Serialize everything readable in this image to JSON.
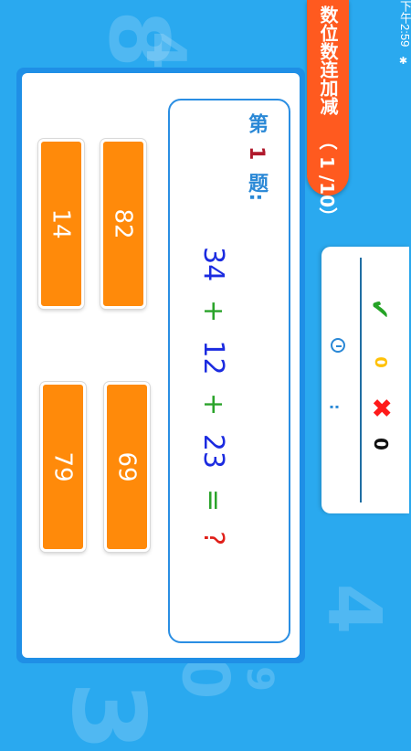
{
  "status_bar": {
    "time": "下午2:59",
    "bluetooth_icon": "bluetooth-icon"
  },
  "title": {
    "name": "数位数连加减",
    "progress": "（ 1 /10）"
  },
  "score": {
    "correct_icon": "checkmark-icon",
    "correct_count": "0",
    "wrong_icon": "x-icon",
    "wrong_count": "0",
    "timer_icon": "clock-icon",
    "timer_text": ":"
  },
  "question": {
    "prefix": "第",
    "number": "1",
    "suffix": "题:",
    "operands": [
      "34",
      "12",
      "23"
    ],
    "operators": [
      "+",
      "+"
    ],
    "equals": "=",
    "unknown": "?"
  },
  "answers": [
    "82",
    "14",
    "69",
    "79"
  ],
  "colors": {
    "background": "#2aa9ef",
    "title_tab": "#ff5a1f",
    "answer_button": "#ff8a0a",
    "operand": "#1b2be0",
    "operator": "#2aa32a",
    "unknown": "#e0201a"
  }
}
